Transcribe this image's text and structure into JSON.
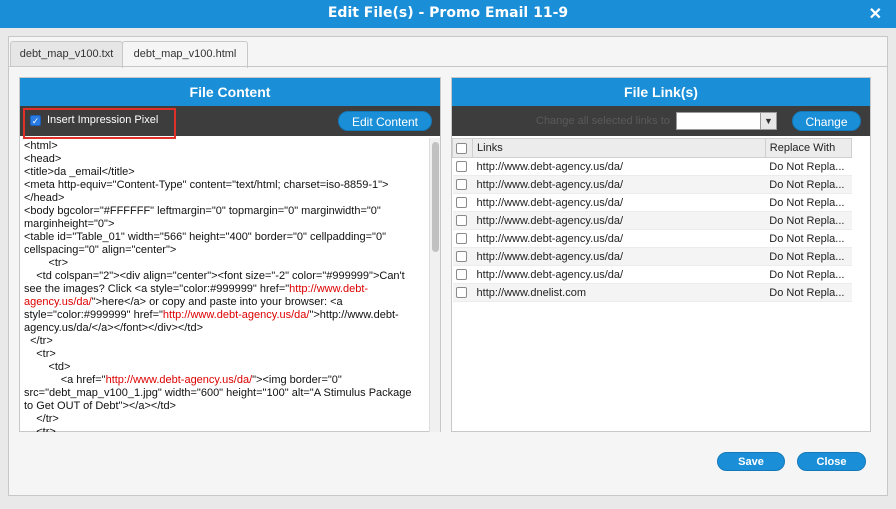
{
  "dialog": {
    "title": "Edit File(s) - Promo Email 11-9",
    "close_glyph": "✕"
  },
  "tabs": [
    {
      "label": "debt_map_v100.txt",
      "active": false
    },
    {
      "label": "debt_map_v100.html",
      "active": true
    }
  ],
  "file_content": {
    "heading": "File Content",
    "insert_pixel_label": "Insert Impression Pixel",
    "insert_pixel_checked": true,
    "edit_button": "Edit Content",
    "code_lines": [
      [
        {
          "t": "<html>"
        }
      ],
      [
        {
          "t": "<head>"
        }
      ],
      [
        {
          "t": "<title>da _email</title>"
        }
      ],
      [
        {
          "t": "<meta http-equiv=\"Content-Type\" content=\"text/html; charset=iso-8859-1\">"
        }
      ],
      [
        {
          "t": "</head>"
        }
      ],
      [
        {
          "t": "<body bgcolor=\"#FFFFFF\" leftmargin=\"0\" topmargin=\"0\" marginwidth=\"0\""
        }
      ],
      [
        {
          "t": "marginheight=\"0\">"
        }
      ],
      [
        {
          "t": "<table id=\"Table_01\" width=\"566\" height=\"400\" border=\"0\" cellpadding=\"0\""
        }
      ],
      [
        {
          "t": "cellspacing=\"0\" align=\"center\">"
        }
      ],
      [
        {
          "t": "        <tr>"
        }
      ],
      [
        {
          "t": "    <td colspan=\"2\"><div align=\"center\"><font size=\"-2\" color=\"#999999\">Can't"
        }
      ],
      [
        {
          "t": "see the images? Click <a style=\"color:#999999\" href=\""
        },
        {
          "t": "http://www.debt-",
          "r": true
        }
      ],
      [
        {
          "t": "agency.us/da/",
          "r": true
        },
        {
          "t": "\">here</a> or copy and paste into your browser: <a"
        }
      ],
      [
        {
          "t": "style=\"color:#999999\" href=\""
        },
        {
          "t": "http://www.debt-agency.us/da/",
          "r": true
        },
        {
          "t": "\">http://www.debt-"
        }
      ],
      [
        {
          "t": "agency.us/da/</a></font></div></td>"
        }
      ],
      [
        {
          "t": "  </tr>"
        }
      ],
      [
        {
          "t": "    <tr>"
        }
      ],
      [
        {
          "t": "        <td>"
        }
      ],
      [
        {
          "t": "            <a href=\""
        },
        {
          "t": "http://www.debt-agency.us/da/",
          "r": true
        },
        {
          "t": "\"><img border=\"0\""
        }
      ],
      [
        {
          "t": "src=\"debt_map_v100_1.jpg\" width=\"600\" height=\"100\" alt=\"A Stimulus Package"
        }
      ],
      [
        {
          "t": "to Get OUT of Debt\"></a></td>"
        }
      ],
      [
        {
          "t": "    </tr>"
        }
      ],
      [
        {
          "t": "    <tr>"
        }
      ]
    ]
  },
  "file_links": {
    "heading": "File Link(s)",
    "change_label": "Change all selected links to",
    "change_button": "Change",
    "columns": [
      "Links",
      "Replace With"
    ],
    "rows": [
      {
        "link": "http://www.debt-agency.us/da/",
        "replace": "Do Not Repla..."
      },
      {
        "link": "http://www.debt-agency.us/da/",
        "replace": "Do Not Repla..."
      },
      {
        "link": "http://www.debt-agency.us/da/",
        "replace": "Do Not Repla..."
      },
      {
        "link": "http://www.debt-agency.us/da/",
        "replace": "Do Not Repla..."
      },
      {
        "link": "http://www.debt-agency.us/da/",
        "replace": "Do Not Repla..."
      },
      {
        "link": "http://www.debt-agency.us/da/",
        "replace": "Do Not Repla..."
      },
      {
        "link": "http://www.debt-agency.us/da/",
        "replace": "Do Not Repla..."
      },
      {
        "link": "http://www.dnelist.com",
        "replace": "Do Not Repla..."
      }
    ]
  },
  "footer": {
    "save": "Save",
    "close": "Close"
  },
  "colors": {
    "accent": "#1a8fd8",
    "toolbar": "#3d3d3d",
    "highlight": "#e0302a",
    "link_red": "#dd0000"
  }
}
